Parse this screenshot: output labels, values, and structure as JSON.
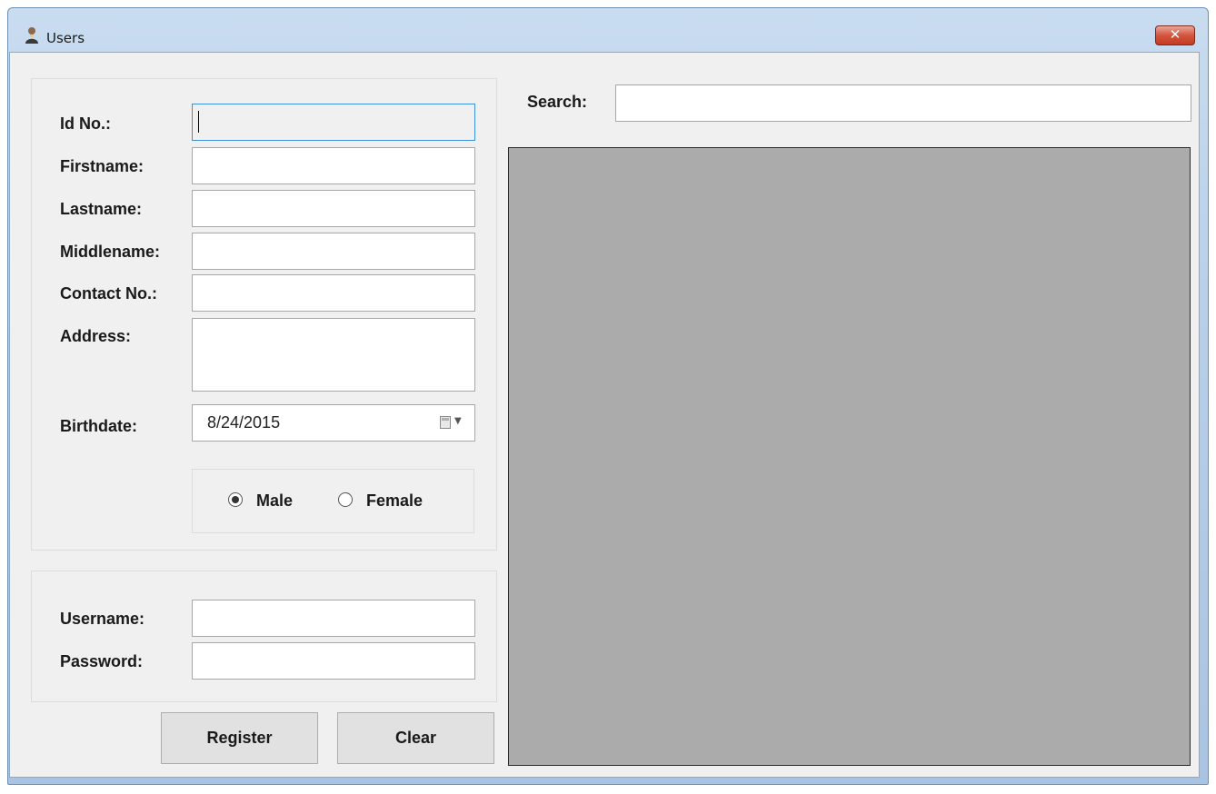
{
  "window": {
    "title": "Users",
    "close_glyph": "✕"
  },
  "form": {
    "id_label": "Id No.:",
    "id_value": "",
    "firstname_label": "Firstname:",
    "firstname_value": "",
    "lastname_label": "Lastname:",
    "lastname_value": "",
    "middlename_label": "Middlename:",
    "middlename_value": "",
    "contact_label": "Contact No.:",
    "contact_value": "",
    "address_label": "Address:",
    "address_value": "",
    "birthdate_label": "Birthdate:",
    "birthdate_value": "8/24/2015",
    "gender": {
      "male_label": "Male",
      "female_label": "Female",
      "selected": "Male"
    }
  },
  "account": {
    "username_label": "Username:",
    "username_value": "",
    "password_label": "Password:",
    "password_value": ""
  },
  "buttons": {
    "register_label": "Register",
    "clear_label": "Clear"
  },
  "search": {
    "label": "Search:",
    "value": ""
  },
  "icons": {
    "app": "user-icon",
    "close": "close-icon",
    "calendar": "calendar-icon"
  },
  "colors": {
    "grid_background": "#ababab",
    "close_button": "#c9452c",
    "focus_border": "#3c8fd8"
  }
}
